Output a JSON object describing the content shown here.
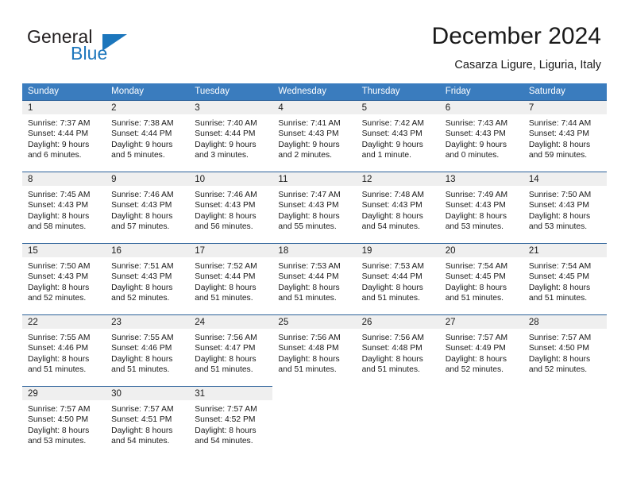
{
  "brand": {
    "name_top": "General",
    "name_bottom": "Blue",
    "triangle_icon": "triangle-logo-icon",
    "accent_color": "#1c76bc"
  },
  "header": {
    "title": "December 2024",
    "location": "Casarza Ligure, Liguria, Italy"
  },
  "calendar": {
    "header_bg_color": "#3a7cbe",
    "daynum_band_color": "#efefef",
    "daynum_border_color": "#2a6099",
    "weekdays": [
      "Sunday",
      "Monday",
      "Tuesday",
      "Wednesday",
      "Thursday",
      "Friday",
      "Saturday"
    ],
    "weeks": [
      [
        {
          "day": "1",
          "sunrise": "Sunrise: 7:37 AM",
          "sunset": "Sunset: 4:44 PM",
          "daylight1": "Daylight: 9 hours",
          "daylight2": "and 6 minutes."
        },
        {
          "day": "2",
          "sunrise": "Sunrise: 7:38 AM",
          "sunset": "Sunset: 4:44 PM",
          "daylight1": "Daylight: 9 hours",
          "daylight2": "and 5 minutes."
        },
        {
          "day": "3",
          "sunrise": "Sunrise: 7:40 AM",
          "sunset": "Sunset: 4:44 PM",
          "daylight1": "Daylight: 9 hours",
          "daylight2": "and 3 minutes."
        },
        {
          "day": "4",
          "sunrise": "Sunrise: 7:41 AM",
          "sunset": "Sunset: 4:43 PM",
          "daylight1": "Daylight: 9 hours",
          "daylight2": "and 2 minutes."
        },
        {
          "day": "5",
          "sunrise": "Sunrise: 7:42 AM",
          "sunset": "Sunset: 4:43 PM",
          "daylight1": "Daylight: 9 hours",
          "daylight2": "and 1 minute."
        },
        {
          "day": "6",
          "sunrise": "Sunrise: 7:43 AM",
          "sunset": "Sunset: 4:43 PM",
          "daylight1": "Daylight: 9 hours",
          "daylight2": "and 0 minutes."
        },
        {
          "day": "7",
          "sunrise": "Sunrise: 7:44 AM",
          "sunset": "Sunset: 4:43 PM",
          "daylight1": "Daylight: 8 hours",
          "daylight2": "and 59 minutes."
        }
      ],
      [
        {
          "day": "8",
          "sunrise": "Sunrise: 7:45 AM",
          "sunset": "Sunset: 4:43 PM",
          "daylight1": "Daylight: 8 hours",
          "daylight2": "and 58 minutes."
        },
        {
          "day": "9",
          "sunrise": "Sunrise: 7:46 AM",
          "sunset": "Sunset: 4:43 PM",
          "daylight1": "Daylight: 8 hours",
          "daylight2": "and 57 minutes."
        },
        {
          "day": "10",
          "sunrise": "Sunrise: 7:46 AM",
          "sunset": "Sunset: 4:43 PM",
          "daylight1": "Daylight: 8 hours",
          "daylight2": "and 56 minutes."
        },
        {
          "day": "11",
          "sunrise": "Sunrise: 7:47 AM",
          "sunset": "Sunset: 4:43 PM",
          "daylight1": "Daylight: 8 hours",
          "daylight2": "and 55 minutes."
        },
        {
          "day": "12",
          "sunrise": "Sunrise: 7:48 AM",
          "sunset": "Sunset: 4:43 PM",
          "daylight1": "Daylight: 8 hours",
          "daylight2": "and 54 minutes."
        },
        {
          "day": "13",
          "sunrise": "Sunrise: 7:49 AM",
          "sunset": "Sunset: 4:43 PM",
          "daylight1": "Daylight: 8 hours",
          "daylight2": "and 53 minutes."
        },
        {
          "day": "14",
          "sunrise": "Sunrise: 7:50 AM",
          "sunset": "Sunset: 4:43 PM",
          "daylight1": "Daylight: 8 hours",
          "daylight2": "and 53 minutes."
        }
      ],
      [
        {
          "day": "15",
          "sunrise": "Sunrise: 7:50 AM",
          "sunset": "Sunset: 4:43 PM",
          "daylight1": "Daylight: 8 hours",
          "daylight2": "and 52 minutes."
        },
        {
          "day": "16",
          "sunrise": "Sunrise: 7:51 AM",
          "sunset": "Sunset: 4:43 PM",
          "daylight1": "Daylight: 8 hours",
          "daylight2": "and 52 minutes."
        },
        {
          "day": "17",
          "sunrise": "Sunrise: 7:52 AM",
          "sunset": "Sunset: 4:44 PM",
          "daylight1": "Daylight: 8 hours",
          "daylight2": "and 51 minutes."
        },
        {
          "day": "18",
          "sunrise": "Sunrise: 7:53 AM",
          "sunset": "Sunset: 4:44 PM",
          "daylight1": "Daylight: 8 hours",
          "daylight2": "and 51 minutes."
        },
        {
          "day": "19",
          "sunrise": "Sunrise: 7:53 AM",
          "sunset": "Sunset: 4:44 PM",
          "daylight1": "Daylight: 8 hours",
          "daylight2": "and 51 minutes."
        },
        {
          "day": "20",
          "sunrise": "Sunrise: 7:54 AM",
          "sunset": "Sunset: 4:45 PM",
          "daylight1": "Daylight: 8 hours",
          "daylight2": "and 51 minutes."
        },
        {
          "day": "21",
          "sunrise": "Sunrise: 7:54 AM",
          "sunset": "Sunset: 4:45 PM",
          "daylight1": "Daylight: 8 hours",
          "daylight2": "and 51 minutes."
        }
      ],
      [
        {
          "day": "22",
          "sunrise": "Sunrise: 7:55 AM",
          "sunset": "Sunset: 4:46 PM",
          "daylight1": "Daylight: 8 hours",
          "daylight2": "and 51 minutes."
        },
        {
          "day": "23",
          "sunrise": "Sunrise: 7:55 AM",
          "sunset": "Sunset: 4:46 PM",
          "daylight1": "Daylight: 8 hours",
          "daylight2": "and 51 minutes."
        },
        {
          "day": "24",
          "sunrise": "Sunrise: 7:56 AM",
          "sunset": "Sunset: 4:47 PM",
          "daylight1": "Daylight: 8 hours",
          "daylight2": "and 51 minutes."
        },
        {
          "day": "25",
          "sunrise": "Sunrise: 7:56 AM",
          "sunset": "Sunset: 4:48 PM",
          "daylight1": "Daylight: 8 hours",
          "daylight2": "and 51 minutes."
        },
        {
          "day": "26",
          "sunrise": "Sunrise: 7:56 AM",
          "sunset": "Sunset: 4:48 PM",
          "daylight1": "Daylight: 8 hours",
          "daylight2": "and 51 minutes."
        },
        {
          "day": "27",
          "sunrise": "Sunrise: 7:57 AM",
          "sunset": "Sunset: 4:49 PM",
          "daylight1": "Daylight: 8 hours",
          "daylight2": "and 52 minutes."
        },
        {
          "day": "28",
          "sunrise": "Sunrise: 7:57 AM",
          "sunset": "Sunset: 4:50 PM",
          "daylight1": "Daylight: 8 hours",
          "daylight2": "and 52 minutes."
        }
      ],
      [
        {
          "day": "29",
          "sunrise": "Sunrise: 7:57 AM",
          "sunset": "Sunset: 4:50 PM",
          "daylight1": "Daylight: 8 hours",
          "daylight2": "and 53 minutes."
        },
        {
          "day": "30",
          "sunrise": "Sunrise: 7:57 AM",
          "sunset": "Sunset: 4:51 PM",
          "daylight1": "Daylight: 8 hours",
          "daylight2": "and 54 minutes."
        },
        {
          "day": "31",
          "sunrise": "Sunrise: 7:57 AM",
          "sunset": "Sunset: 4:52 PM",
          "daylight1": "Daylight: 8 hours",
          "daylight2": "and 54 minutes."
        },
        {
          "day": "",
          "sunrise": "",
          "sunset": "",
          "daylight1": "",
          "daylight2": ""
        },
        {
          "day": "",
          "sunrise": "",
          "sunset": "",
          "daylight1": "",
          "daylight2": ""
        },
        {
          "day": "",
          "sunrise": "",
          "sunset": "",
          "daylight1": "",
          "daylight2": ""
        },
        {
          "day": "",
          "sunrise": "",
          "sunset": "",
          "daylight1": "",
          "daylight2": ""
        }
      ]
    ]
  }
}
